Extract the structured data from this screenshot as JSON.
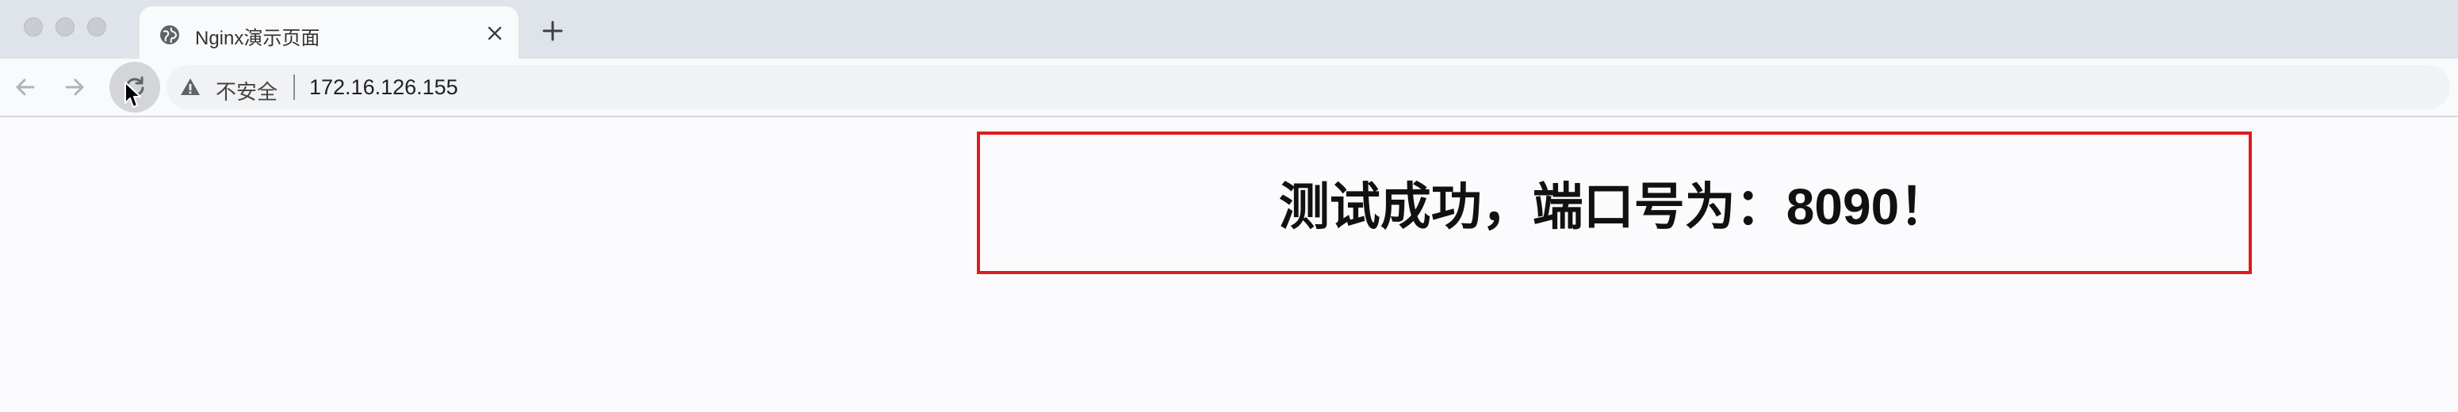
{
  "tab": {
    "title": "Nginx演示页面",
    "favicon": "globe-icon",
    "close_icon": "close-icon"
  },
  "new_tab_icon": "plus-icon",
  "toolbar": {
    "back_icon": "back-arrow-icon",
    "forward_icon": "forward-arrow-icon",
    "reload_icon": "reload-icon"
  },
  "address_bar": {
    "security_icon": "warning-icon",
    "security_label": "不安全",
    "url": "172.16.126.155"
  },
  "content": {
    "message": "测试成功，端口号为：8090！",
    "border_color": "#e01b1b"
  }
}
